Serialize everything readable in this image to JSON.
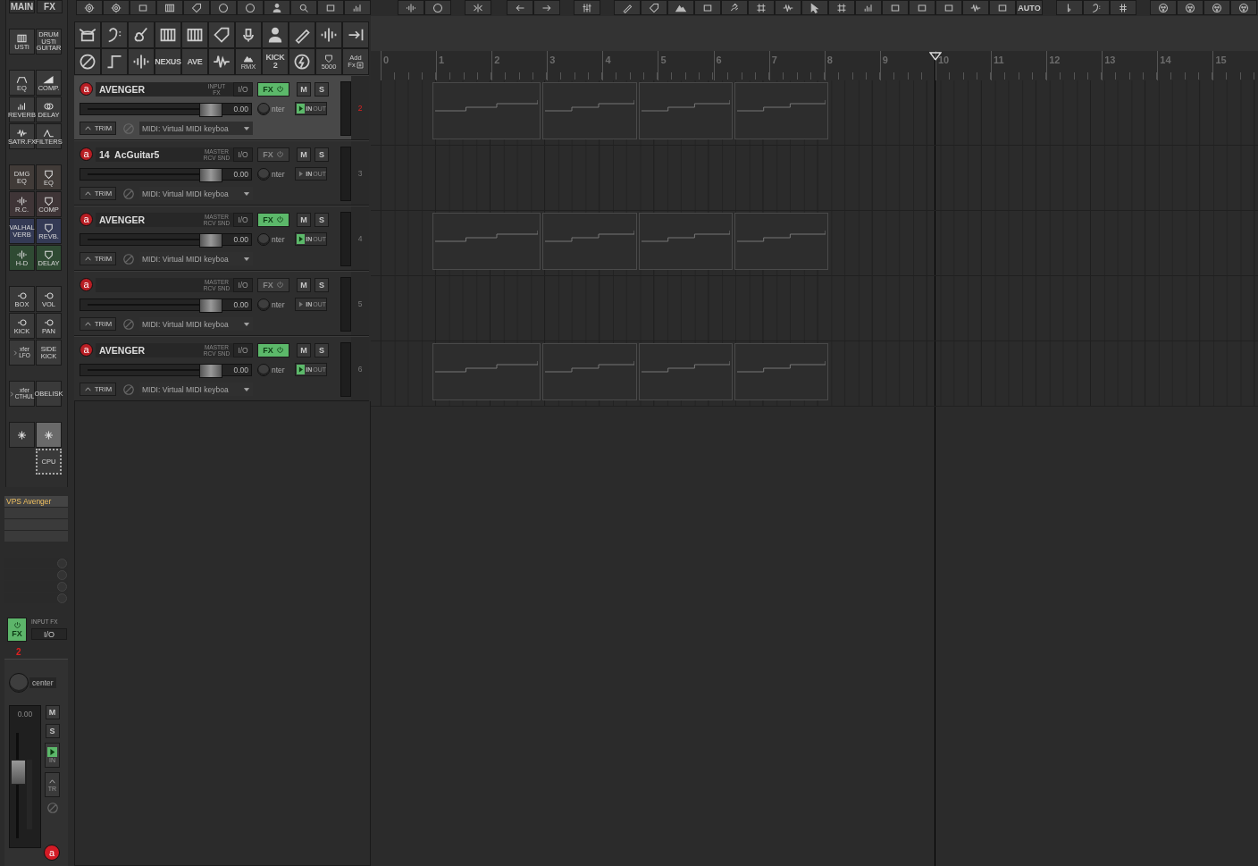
{
  "top_toolbar": {
    "auto_label": "AUTO"
  },
  "launcher": {
    "tabs": [
      "MAIN",
      "FX"
    ],
    "groups": [
      {
        "buttons": [
          {
            "lines": [
              "USTi"
            ],
            "color": "#3a3a3a"
          },
          {
            "lines": [
              "DRUM",
              "USTi",
              "GUITAR"
            ],
            "color": "#3a3a3a"
          }
        ]
      },
      {
        "buttons": [
          {
            "lines": [
              "EQ"
            ],
            "color": "#3a3a3a"
          },
          {
            "lines": [
              "COMP."
            ],
            "color": "#3a3a3a"
          },
          {
            "lines": [
              "REVERB"
            ],
            "color": "#3a3a3a"
          },
          {
            "lines": [
              "DELAY"
            ],
            "color": "#3a3a3a"
          },
          {
            "lines": [
              "SATR.FX"
            ],
            "color": "#3a3a3a"
          },
          {
            "lines": [
              "FILTERS"
            ],
            "color": "#3a3a3a"
          }
        ]
      },
      {
        "buttons": [
          {
            "lines": [
              "DMG",
              "EQ"
            ],
            "color": "#413b38"
          },
          {
            "lines": [
              "EQ"
            ],
            "color": "#413b38"
          },
          {
            "lines": [
              "R.C."
            ],
            "color": "#3f3537"
          },
          {
            "lines": [
              "COMP"
            ],
            "color": "#3f3537"
          },
          {
            "lines": [
              "VALHAL",
              "VERB"
            ],
            "color": "#343a55"
          },
          {
            "lines": [
              "REVB."
            ],
            "color": "#343a55"
          },
          {
            "lines": [
              "H-D"
            ],
            "color": "#2f4a33"
          },
          {
            "lines": [
              "DELAY"
            ],
            "color": "#2f4a33"
          }
        ]
      },
      {
        "buttons": [
          {
            "lines": [
              "BOX"
            ],
            "color": "#3a3a3a"
          },
          {
            "lines": [
              "VOL"
            ],
            "color": "#3a3a3a"
          },
          {
            "lines": [
              "KICK"
            ],
            "color": "#3a3a3a"
          },
          {
            "lines": [
              "PAN"
            ],
            "color": "#3a3a3a"
          },
          {
            "lines": [
              "xfer",
              "LFO"
            ],
            "color": "#3a3a3a"
          },
          {
            "lines": [
              "SIDE",
              "KICK"
            ],
            "color": "#3a3a3a"
          }
        ]
      },
      {
        "buttons": [
          {
            "lines": [
              "xfer",
              "CTHUL"
            ],
            "color": "#3a3a3a"
          },
          {
            "lines": [
              "OBELISK"
            ],
            "color": "#3a3a3a"
          }
        ]
      },
      {
        "buttons": [
          {
            "lines": [
              "CPU"
            ],
            "color": "#3a3a3a"
          }
        ]
      }
    ]
  },
  "plugin_toolbar": {
    "row_2": [
      {
        "kind": "icon"
      },
      {
        "kind": "icon"
      },
      {
        "kind": "icon"
      },
      {
        "kind": "text",
        "lines": [
          "NEXUS"
        ]
      },
      {
        "kind": "text",
        "lines": [
          "AVE"
        ]
      },
      {
        "kind": "icon"
      },
      {
        "kind": "icon_text",
        "lines": [
          "RMX"
        ]
      },
      {
        "kind": "text",
        "lines": [
          "KICK",
          "2"
        ]
      },
      {
        "kind": "icon"
      },
      {
        "kind": "icon_text",
        "lines": [
          "5000"
        ]
      },
      {
        "kind": "add",
        "lines": [
          "Add",
          "Fx"
        ]
      }
    ]
  },
  "tracks": [
    {
      "name": "AVENGER",
      "number": "2",
      "selected": true,
      "rec": "a",
      "routing": [
        "INPUT",
        "FX"
      ],
      "io": "I/O",
      "fx": "FX",
      "fx_on": true,
      "mute": "M",
      "solo": "S",
      "volume": "0.00",
      "level": 0.77,
      "pan": "nter",
      "in": "IN",
      "out": "OUT",
      "armed": true,
      "trim": "TRIM",
      "input": "MIDI: Virtual MIDI keyboa",
      "has_items": true
    },
    {
      "name": "14  AcGuitar5",
      "number": "3",
      "selected": false,
      "rec": "a",
      "routing": [
        "MASTER",
        "RCV SND"
      ],
      "io": "I/O",
      "fx": "FX",
      "fx_on": false,
      "mute": "M",
      "solo": "S",
      "volume": "0.00",
      "level": 0.77,
      "pan": "nter",
      "in": "IN",
      "out": "OUT",
      "armed": false,
      "trim": "TRIM",
      "input": "MIDI: Virtual MIDI keyboa",
      "has_items": false
    },
    {
      "name": "AVENGER",
      "number": "4",
      "selected": false,
      "rec": "a",
      "routing": [
        "MASTER",
        "RCV SND"
      ],
      "io": "I/O",
      "fx": "FX",
      "fx_on": true,
      "mute": "M",
      "solo": "S",
      "volume": "0.00",
      "level": 0.77,
      "pan": "nter",
      "in": "IN",
      "out": "OUT",
      "armed": true,
      "trim": "TRIM",
      "input": "MIDI: Virtual MIDI keyboa",
      "has_items": true
    },
    {
      "number": "5",
      "selected": false,
      "rec": "a",
      "routing": [
        "MASTER",
        "RCV SND"
      ],
      "io": "I/O",
      "fx": "FX",
      "fx_on": false,
      "mute": "M",
      "solo": "S",
      "volume": "0.00",
      "level": 0.77,
      "pan": "nter",
      "in": "IN",
      "out": "OUT",
      "armed": false,
      "trim": "TRIM",
      "input": "MIDI: Virtual MIDI keyboa",
      "has_items": false
    },
    {
      "name": "AVENGER",
      "number": "6",
      "selected": false,
      "rec": "a",
      "routing": [
        "MASTER",
        "RCV SND"
      ],
      "io": "I/O",
      "fx": "FX",
      "fx_on": true,
      "mute": "M",
      "solo": "S",
      "volume": "0.00",
      "level": 0.77,
      "pan": "nter",
      "in": "IN",
      "out": "OUT",
      "armed": true,
      "trim": "TRIM",
      "input": "MIDI: Virtual MIDI keyboa",
      "has_items": true
    }
  ],
  "ruler": {
    "marks": [
      {
        "label": "0",
        "playhead": false
      },
      {
        "label": "1",
        "playhead": false
      },
      {
        "label": "2",
        "playhead": false
      },
      {
        "label": "3",
        "playhead": false
      },
      {
        "label": "4",
        "playhead": false
      },
      {
        "label": "5",
        "playhead": false
      },
      {
        "label": "6",
        "playhead": false
      },
      {
        "label": "7",
        "playhead": false
      },
      {
        "label": "8",
        "playhead": false
      },
      {
        "label": "9",
        "playhead": false
      },
      {
        "label": "10",
        "playhead": true
      },
      {
        "label": "11",
        "playhead": false
      },
      {
        "label": "12",
        "playhead": false
      },
      {
        "label": "13",
        "playhead": false
      },
      {
        "label": "14",
        "playhead": false
      },
      {
        "label": "15",
        "playhead": false
      }
    ]
  },
  "mixer": {
    "fx_chain": [
      "VPS Avenger"
    ],
    "fx": "FX",
    "fx_on": true,
    "input_fx": "INPUT FX",
    "io": "I/O",
    "number": "2",
    "pan": "center",
    "volume": "0.00",
    "level": 0.62,
    "mute": "M",
    "solo": "S",
    "in": "IN",
    "armed": true,
    "trim": "TR",
    "rec": "a"
  }
}
